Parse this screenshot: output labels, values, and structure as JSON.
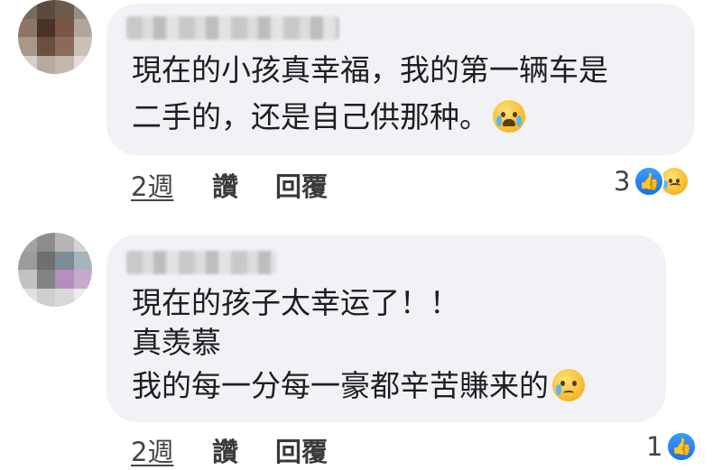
{
  "comments": [
    {
      "author": "",
      "lines": [
        "現在的小孩真幸福，我的第一辆车是",
        "二手的，还是自己供那种。"
      ],
      "emoji": "loudly-crying-face-emoji",
      "time": "2週",
      "like_label": "讚",
      "reply_label": "回覆",
      "reaction_count": "3",
      "reactions": [
        "like-icon",
        "sad-icon"
      ]
    },
    {
      "author": "",
      "lines": [
        "現在的孩子太幸运了！！",
        "真羡慕",
        "我的每一分每一豪都辛苦賺来的"
      ],
      "emoji": "crying-face-emoji",
      "time": "2週",
      "like_label": "讚",
      "reply_label": "回覆",
      "reaction_count": "1",
      "reactions": [
        "like-icon"
      ]
    }
  ],
  "colors": {
    "bubble": "#f0f2f5",
    "like_blue": "#1773ea",
    "text": "#1c1e21",
    "meta": "#444444"
  }
}
